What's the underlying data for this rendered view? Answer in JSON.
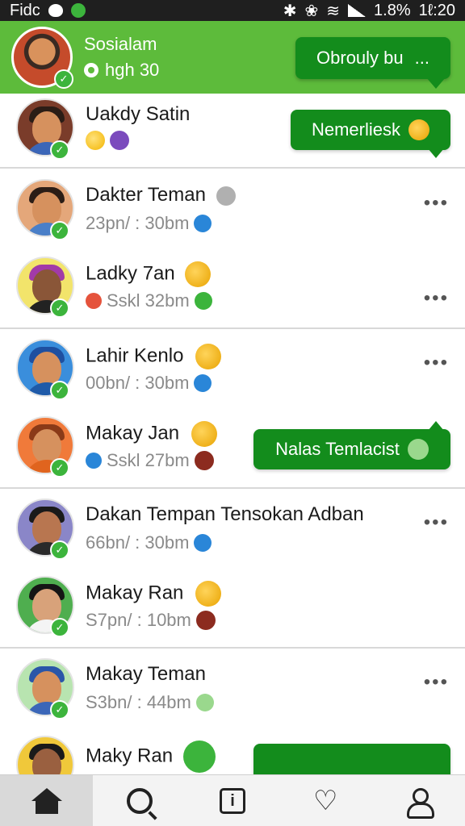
{
  "status_bar": {
    "carrier": "Fidc",
    "battery": "1.8%",
    "time": "1ℓ:20"
  },
  "header": {
    "title": "Sosialam",
    "subtitle": "hgh 30",
    "button_label": "Obrouly bu",
    "button_dots": "..."
  },
  "rows": [
    {
      "name": "Uakdy Satin",
      "meta": "",
      "bubble": "Nemerliesk"
    },
    {
      "name": "Dakter Teman",
      "meta": "23pn/ : 30bm"
    },
    {
      "name": "Ladky 7an",
      "meta": "Sskl 32bm"
    },
    {
      "name": "Lahir Kenlo",
      "meta": "00bn/ : 30bm"
    },
    {
      "name": "Makay Jan",
      "meta": "Sskl 27bm",
      "bubble": "Nalas Temlacist"
    },
    {
      "name": "Dakan Tempan Tensokan Adban",
      "meta": "66bn/ : 30bm"
    },
    {
      "name": "Makay Ran",
      "meta": "S7pn/ : 10bm"
    },
    {
      "name": "Makay Teman",
      "meta": "S3bn/ : 44bm"
    },
    {
      "name": "Maky Ran",
      "meta": ""
    }
  ],
  "more_label": "•••",
  "nav": {
    "home": "home",
    "search": "search",
    "info": "i",
    "favorites": "♡",
    "profile": "profile"
  },
  "colors": {
    "header_green": "#5dbb3b",
    "button_green": "#138c1c",
    "verified_green": "#3cb43c"
  }
}
